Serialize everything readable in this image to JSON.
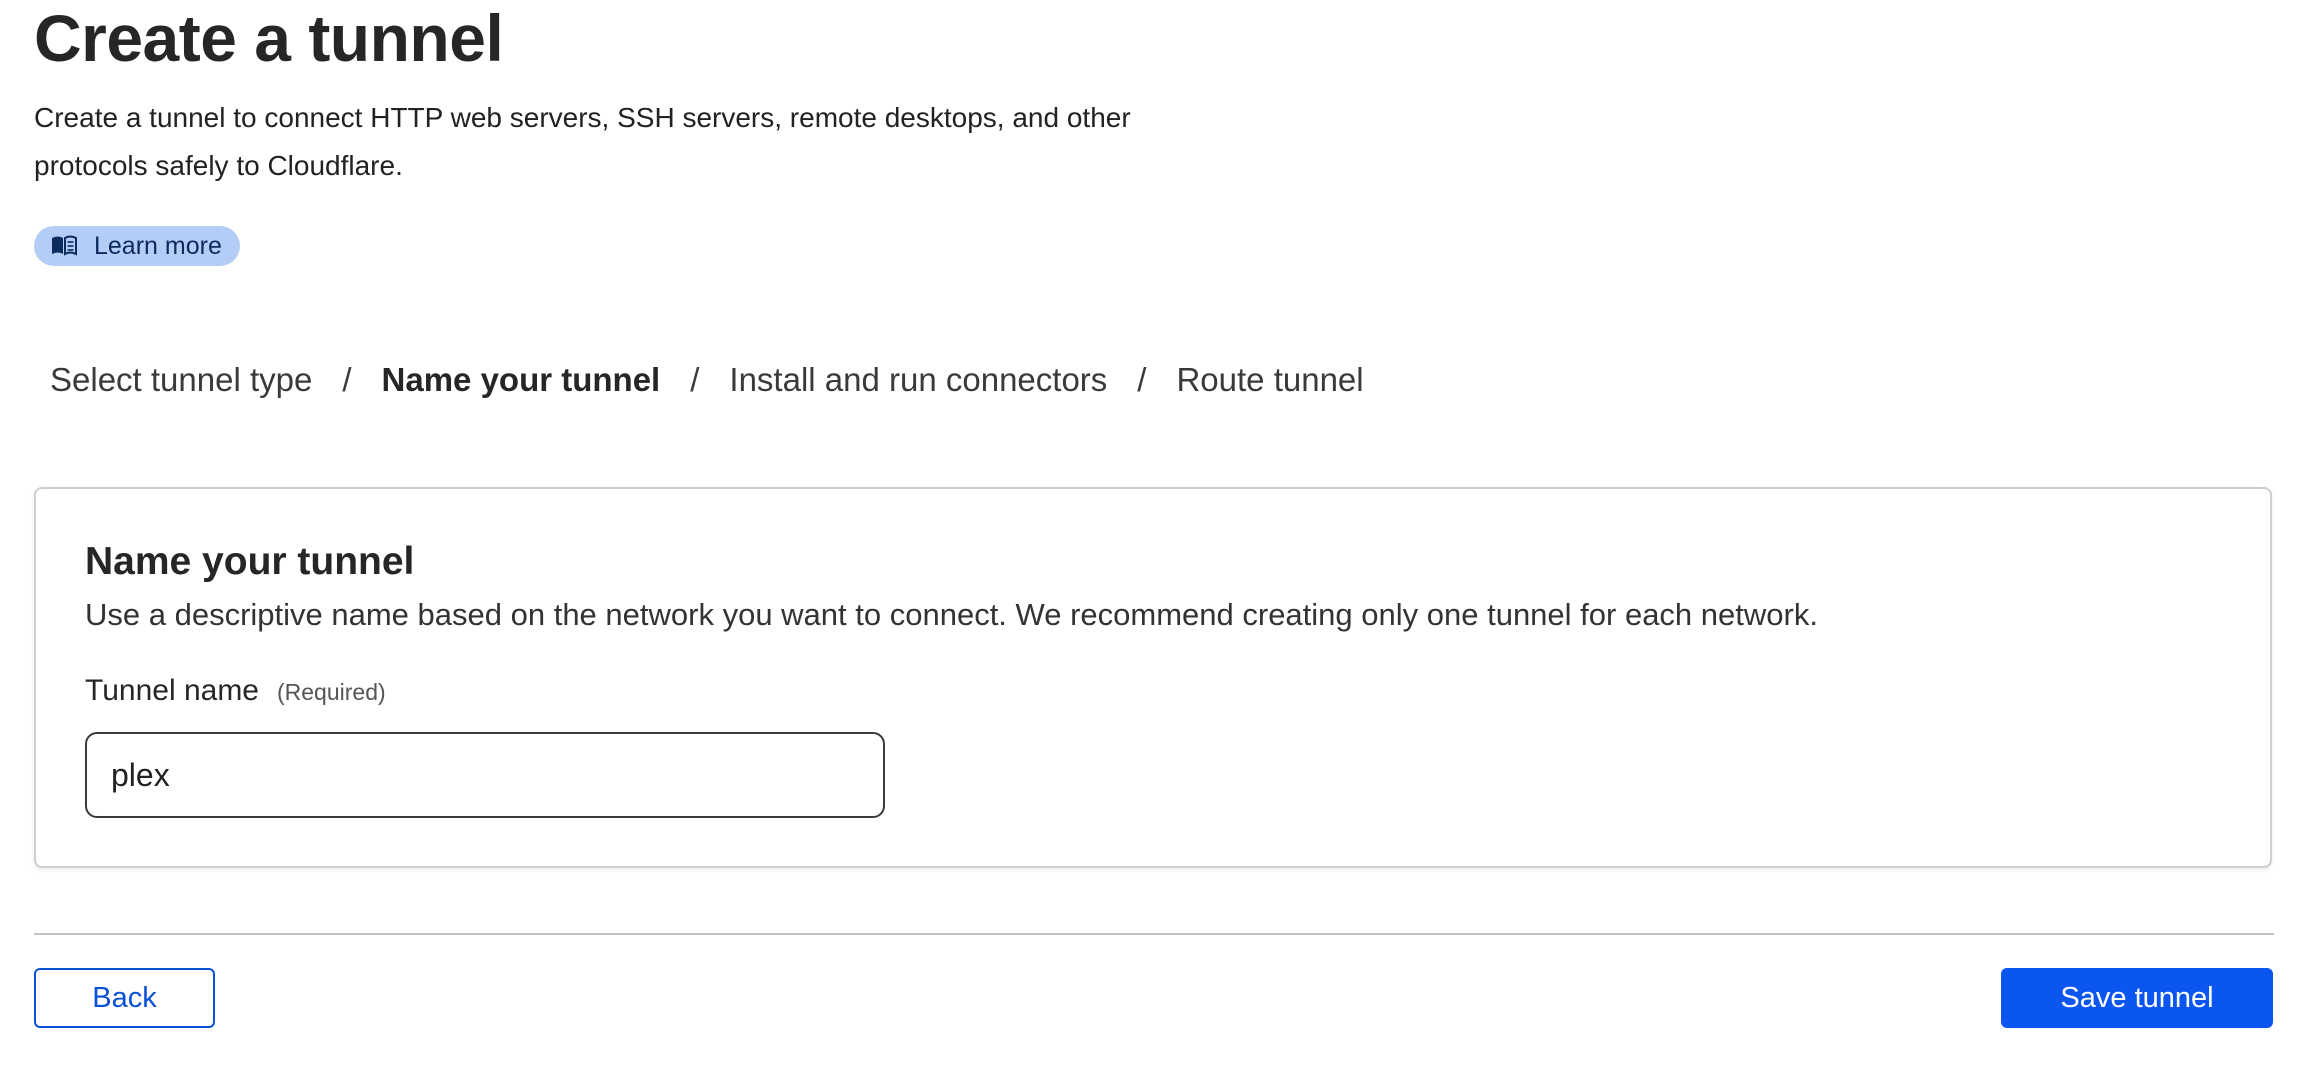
{
  "header": {
    "title": "Create a tunnel",
    "description": "Create a tunnel to connect HTTP web servers, SSH servers, remote desktops, and other protocols safely to Cloudflare.",
    "learn_more": {
      "label": "Learn more",
      "icon": "book-icon"
    }
  },
  "steps": {
    "separator": "/",
    "items": [
      {
        "label": "Select tunnel type",
        "active": false
      },
      {
        "label": "Name your tunnel",
        "active": true
      },
      {
        "label": "Install and run connectors",
        "active": false
      },
      {
        "label": "Route tunnel",
        "active": false
      }
    ]
  },
  "card": {
    "title": "Name your tunnel",
    "description": "Use a descriptive name based on the network you want to connect. We recommend creating only one tunnel for each network.",
    "field": {
      "label": "Tunnel name",
      "required_label": "(Required)",
      "value": "plex"
    }
  },
  "footer": {
    "back_label": "Back",
    "save_label": "Save tunnel"
  },
  "colors": {
    "primary": "#0b55f0",
    "learn_more_bg": "#b3cdf7",
    "learn_more_text": "#0b2a5e"
  }
}
